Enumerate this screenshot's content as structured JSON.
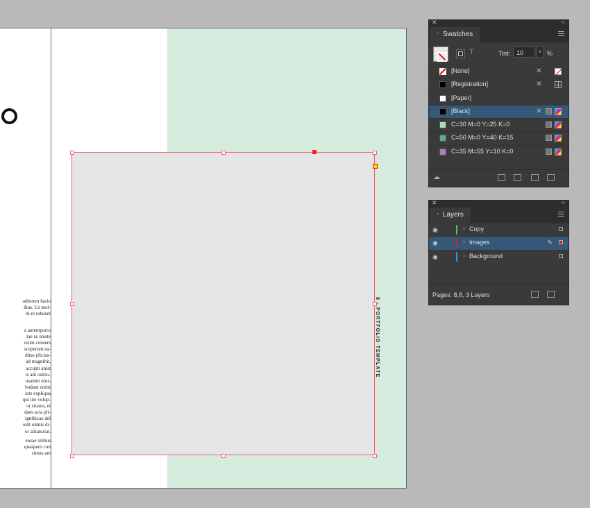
{
  "document": {
    "side_label": "8 - PORTFOLIO TEMPLATE",
    "body_paragraphs": [
      "odiorem hario\nibus. Us mol-\nm re rehenet",
      "a autemporro\ntae as uteste\norum consers\nsceperum ea-\nditas plicius-\nad magnihit,\naccupti anist\nis adi oditio-\nusanim olor-\nbudam entist\nicte expliqua\nqui ute volup-\nor sitatus, et\ndaes acia pli-\nignihicae del\noldi omnis di-\nor alitaturiat.",
      "eosae sitibus\nquaspero con\nsimus am"
    ]
  },
  "swatches_panel": {
    "tab_label": "Swatches",
    "tint_label": "Tint:",
    "tint_value": "10",
    "tint_arrow": ">",
    "percent": "%",
    "fmt_text_glyph": "T",
    "items": [
      {
        "name": "[None]",
        "chip": "none",
        "icon_c": "none"
      },
      {
        "name": "[Registration]",
        "chip": "#000000",
        "icon_c": "reg"
      },
      {
        "name": "[Paper]",
        "chip": "#ffffff",
        "icon_c": ""
      },
      {
        "name": "[Black]",
        "chip": "#000000",
        "icon_c": "cmyk",
        "selected": true
      },
      {
        "name": "C=30 M=0 Y=25 K=0",
        "chip": "#aadcc6",
        "icon_c": "cmyk"
      },
      {
        "name": "C=50 M=0 Y=40 K=15",
        "chip": "#5fa88a",
        "icon_c": "cmyk"
      },
      {
        "name": "C=35 M=55 Y=10 K=0",
        "chip": "#a983b8",
        "icon_c": "cmyk"
      }
    ]
  },
  "layers_panel": {
    "tab_label": "Layers",
    "status": "Pages: 8,8, 3 Layers",
    "layers": [
      {
        "name": "Copy",
        "color": "#3ecf4a",
        "selected": false
      },
      {
        "name": "Images",
        "color": "#e02020",
        "selected": true
      },
      {
        "name": "Background",
        "color": "#3c8ee0",
        "selected": false
      }
    ]
  },
  "colors": {
    "selection": "#ff5a6a",
    "panel_bg": "#3a3a3a",
    "row_selected": "#365878",
    "page_green": "#d5ebde"
  }
}
